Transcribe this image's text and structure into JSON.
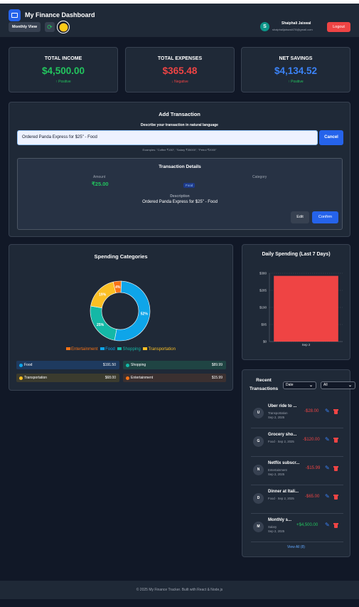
{
  "header": {
    "title": "My Finance Dashboard",
    "view_label": "Monthly View",
    "user_initial": "S",
    "user_name": "Shaiphali Jaiswal",
    "user_email": "shaiphalijaiswal478@gmail.com",
    "logout_label": "Logout"
  },
  "stats": [
    {
      "label": "TOTAL INCOME",
      "value": "$4,500.00",
      "note": "↑ Positive"
    },
    {
      "label": "TOTAL EXPENSES",
      "value": "$365.48",
      "note": "↓ Negative"
    },
    {
      "label": "NET SAVINGS",
      "value": "$4,134.52",
      "note": "↑ Positive"
    }
  ],
  "add_transaction": {
    "title": "Add Transaction",
    "prompt": "Describe your transaction in natural language",
    "input_value": "Ordered Panda Express for $25\" - Food",
    "cancel_label": "Cancel",
    "examples": "Examples: \"Coffee ₹150\", \"Salary ₹35000\", \"Petrol ₹2000\"",
    "details": {
      "title": "Transaction Details",
      "amount_label": "Amount",
      "amount": "₹25.00",
      "category_label": "Category",
      "category": "Food",
      "description_label": "Description",
      "description": "Ordered Panda Express for $25\" - Food",
      "edit_label": "Edit",
      "confirm_label": "Confirm"
    }
  },
  "spending_categories": {
    "title": "Spending Categories",
    "legend": [
      "Entertainment",
      "Food",
      "Shopping",
      "Transportation"
    ],
    "rows": [
      {
        "name": "Food",
        "value": "$191.50"
      },
      {
        "name": "Shopping",
        "value": "$89.99"
      },
      {
        "name": "Transportation",
        "value": "$68.00"
      },
      {
        "name": "Entertainment",
        "value": "$15.99"
      }
    ]
  },
  "colors": {
    "food": "#0ea5e9",
    "shopping": "#14b8a6",
    "transportation": "#fbbf24",
    "entertainment": "#f97316",
    "bar": "#ef4444",
    "income": "#22c55e",
    "expense": "#ef4444",
    "savings": "#3b82f6"
  },
  "daily_spending": {
    "title": "Daily Spending (Last 7 Days)"
  },
  "chart_data": [
    {
      "type": "pie",
      "title": "Spending Categories",
      "categories": [
        "Food",
        "Shopping",
        "Transportation",
        "Entertainment"
      ],
      "values": [
        191.5,
        89.99,
        68.0,
        15.99
      ],
      "data_labels": [
        "52%",
        "25%",
        "19%",
        "4%"
      ]
    },
    {
      "type": "bar",
      "title": "Daily Spending (Last 7 Days)",
      "categories": [
        "Sep 2"
      ],
      "values": [
        365.48
      ],
      "y_ticks": [
        "$0",
        "$95",
        "$190",
        "$285",
        "$380"
      ],
      "ylim": [
        0,
        380
      ]
    }
  ],
  "recent": {
    "title_line1": "Recent",
    "title_line2": "Transactions",
    "sort_filter": "Date",
    "type_filter": "All",
    "items": [
      {
        "initial": "U",
        "name": "Uber ride to ...",
        "category": "Transportation",
        "date": "Sep 2, 2025",
        "amount": "-$28.00"
      },
      {
        "initial": "G",
        "name": "Grocery sho...",
        "meta": "Food · Sep 2, 2025",
        "amount": "-$120.00"
      },
      {
        "initial": "N",
        "name": "Netflix subscr...",
        "category": "Entertainment",
        "date": "Sep 2, 2025",
        "amount": "-$15.99"
      },
      {
        "initial": "D",
        "name": "Dinner at Itali...",
        "meta": "Food · Sep 2, 2025",
        "amount": "-$65.00"
      },
      {
        "initial": "M",
        "name": "Monthly s...",
        "category": "Salary",
        "date": "Sep 2, 2025",
        "amount": "+$4,500.00"
      }
    ],
    "view_all": "View All (8)"
  },
  "footer": "© 2025 My Finance Tracker. Built with React & Node.js"
}
